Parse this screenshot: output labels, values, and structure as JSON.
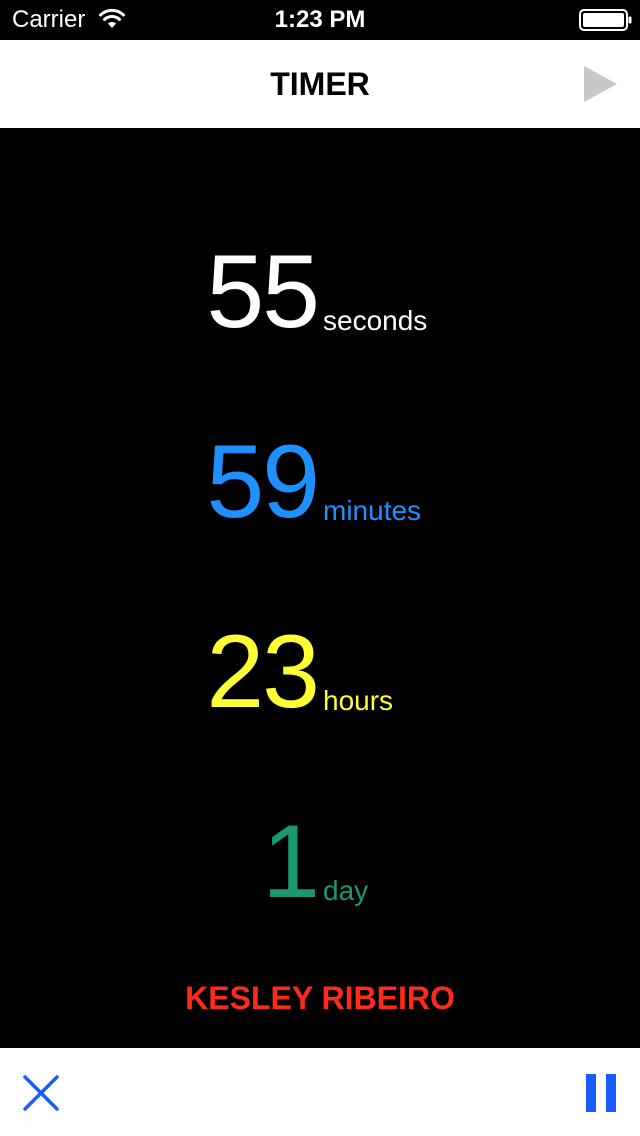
{
  "status_bar": {
    "carrier": "Carrier",
    "time": "1:23 PM",
    "wifi_icon": "wifi-icon",
    "battery_icon": "battery-icon"
  },
  "nav": {
    "title": "TIMER",
    "play_icon": "play-icon"
  },
  "timer": {
    "seconds": {
      "value": "55",
      "unit": "seconds",
      "color": "#ffffff"
    },
    "minutes": {
      "value": "59",
      "unit": "minutes",
      "color": "#1e90ff"
    },
    "hours": {
      "value": "23",
      "unit": "hours",
      "color": "#ffff33"
    },
    "days": {
      "value": "1",
      "unit": "day",
      "color": "#1a9a6c"
    }
  },
  "author": {
    "name": "KESLEY RIBEIRO",
    "color": "#ff2a1a"
  },
  "toolbar": {
    "close_icon": "close-icon",
    "pause_icon": "pause-icon",
    "accent": "#1a5cff"
  },
  "colors": {
    "background": "#000000",
    "bars": "#ffffff",
    "play_icon": "#c8c8c8"
  }
}
